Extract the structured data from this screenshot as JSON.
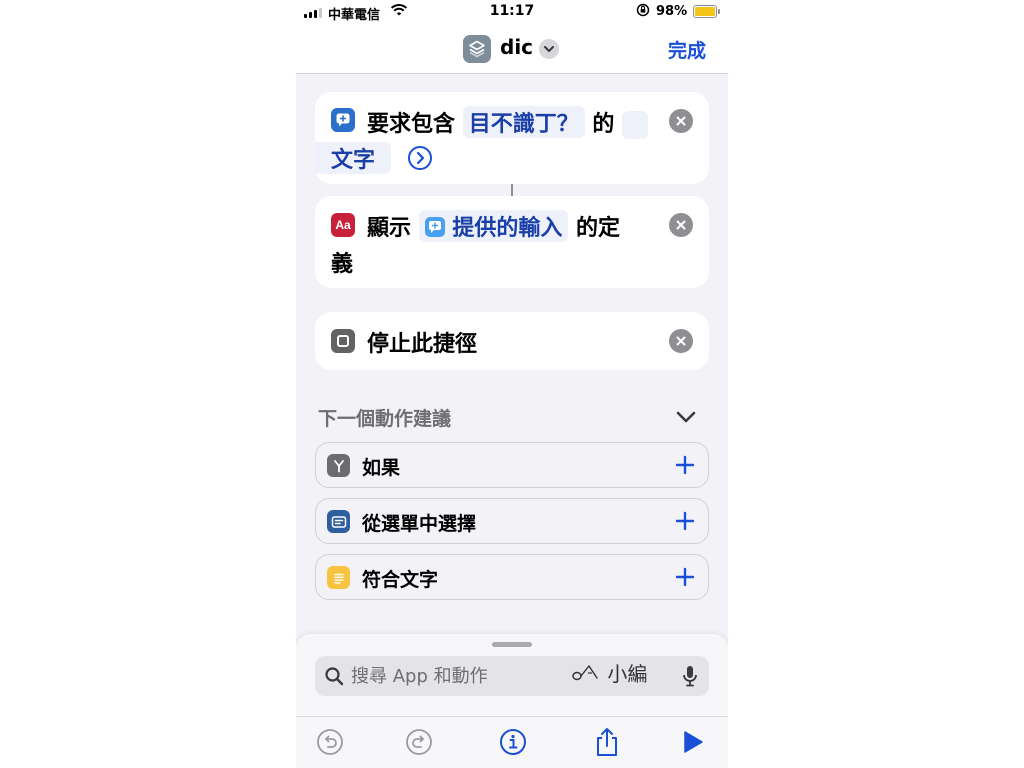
{
  "status_bar": {
    "carrier": "中華電信",
    "time": "11:17",
    "battery": "98%",
    "battery_level": 0.98
  },
  "nav": {
    "title": "dic",
    "done_label": "完成"
  },
  "actions": [
    {
      "icon": "ask-input-icon",
      "text_before": "要求包含",
      "token": "目不識丁？",
      "text_after": "的",
      "line2_token": "文字"
    },
    {
      "icon": "dictionary-icon",
      "text_before": "顯示",
      "token": "提供的輸入",
      "text_after": "的定",
      "line2_text": "義"
    },
    {
      "icon": "stop-icon",
      "text": "停止此捷徑"
    }
  ],
  "suggestions": {
    "heading": "下一個動作建議",
    "items": [
      {
        "label": "如果",
        "icon": "if-branch-icon",
        "color": "#6b6b70"
      },
      {
        "label": "從選單中選擇",
        "icon": "menu-select-icon",
        "color": "#2f5f9e"
      },
      {
        "label": "符合文字",
        "icon": "match-text-icon",
        "color": "#f6c440"
      }
    ]
  },
  "search": {
    "placeholder": "搜尋 App 和動作",
    "watermark": "小編"
  },
  "colors": {
    "accent": "#1a4fd6",
    "token_text": "#1a3fa8",
    "ask_icon_bg": "#2a6fc9",
    "dictionary_icon_bg": "#c8213a"
  }
}
